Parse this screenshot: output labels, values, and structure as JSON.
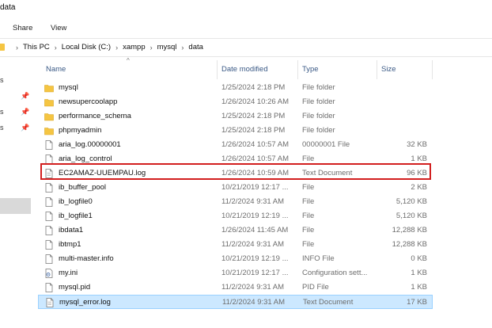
{
  "window": {
    "title": "data"
  },
  "ribbon": {
    "tabs": [
      "Share",
      "View"
    ]
  },
  "address": {
    "crumbs": [
      "This PC",
      "Local Disk (C:)",
      "xampp",
      "mysql",
      "data"
    ],
    "separator": "›"
  },
  "navigation": {
    "truncated_labels": [
      "s",
      "s",
      "s"
    ],
    "pin_glyph": "📌"
  },
  "columns": {
    "name": "Name",
    "date": "Date modified",
    "type": "Type",
    "size": "Size",
    "sort_indicator": "^"
  },
  "files": [
    {
      "name": "mysql",
      "date": "1/25/2024 2:18 PM",
      "type": "File folder",
      "size": "",
      "icon": "folder-icon"
    },
    {
      "name": "newsupercoolapp",
      "date": "1/26/2024 10:26 AM",
      "type": "File folder",
      "size": "",
      "icon": "folder-icon"
    },
    {
      "name": "performance_schema",
      "date": "1/25/2024 2:18 PM",
      "type": "File folder",
      "size": "",
      "icon": "folder-icon"
    },
    {
      "name": "phpmyadmin",
      "date": "1/25/2024 2:18 PM",
      "type": "File folder",
      "size": "",
      "icon": "folder-icon"
    },
    {
      "name": "aria_log.00000001",
      "date": "1/26/2024 10:57 AM",
      "type": "00000001 File",
      "size": "32 KB",
      "icon": "file-icon"
    },
    {
      "name": "aria_log_control",
      "date": "1/26/2024 10:57 AM",
      "type": "File",
      "size": "1 KB",
      "icon": "file-icon"
    },
    {
      "name": "EC2AMAZ-UUEMPAU.log",
      "date": "1/26/2024 10:59 AM",
      "type": "Text Document",
      "size": "96 KB",
      "icon": "text-document-icon"
    },
    {
      "name": "ib_buffer_pool",
      "date": "10/21/2019 12:17 ...",
      "type": "File",
      "size": "2 KB",
      "icon": "file-icon"
    },
    {
      "name": "ib_logfile0",
      "date": "11/2/2024 9:31 AM",
      "type": "File",
      "size": "5,120 KB",
      "icon": "file-icon"
    },
    {
      "name": "ib_logfile1",
      "date": "10/21/2019 12:19 ...",
      "type": "File",
      "size": "5,120 KB",
      "icon": "file-icon"
    },
    {
      "name": "ibdata1",
      "date": "1/26/2024 11:45 AM",
      "type": "File",
      "size": "12,288 KB",
      "icon": "file-icon"
    },
    {
      "name": "ibtmp1",
      "date": "11/2/2024 9:31 AM",
      "type": "File",
      "size": "12,288 KB",
      "icon": "file-icon"
    },
    {
      "name": "multi-master.info",
      "date": "10/21/2019 12:19 ...",
      "type": "INFO File",
      "size": "0 KB",
      "icon": "file-icon"
    },
    {
      "name": "my.ini",
      "date": "10/21/2019 12:17 ...",
      "type": "Configuration sett...",
      "size": "1 KB",
      "icon": "config-file-icon"
    },
    {
      "name": "mysql.pid",
      "date": "11/2/2024 9:31 AM",
      "type": "PID File",
      "size": "1 KB",
      "icon": "file-icon"
    },
    {
      "name": "mysql_error.log",
      "date": "11/2/2024 9:31 AM",
      "type": "Text Document",
      "size": "17 KB",
      "icon": "text-document-icon",
      "selected": true
    }
  ],
  "colors": {
    "folder": "#f5c542",
    "selection_bg": "#cce8ff",
    "selection_border": "#99d1ff",
    "highlight_box": "#d21f1f",
    "header_text": "#3b5a86"
  }
}
